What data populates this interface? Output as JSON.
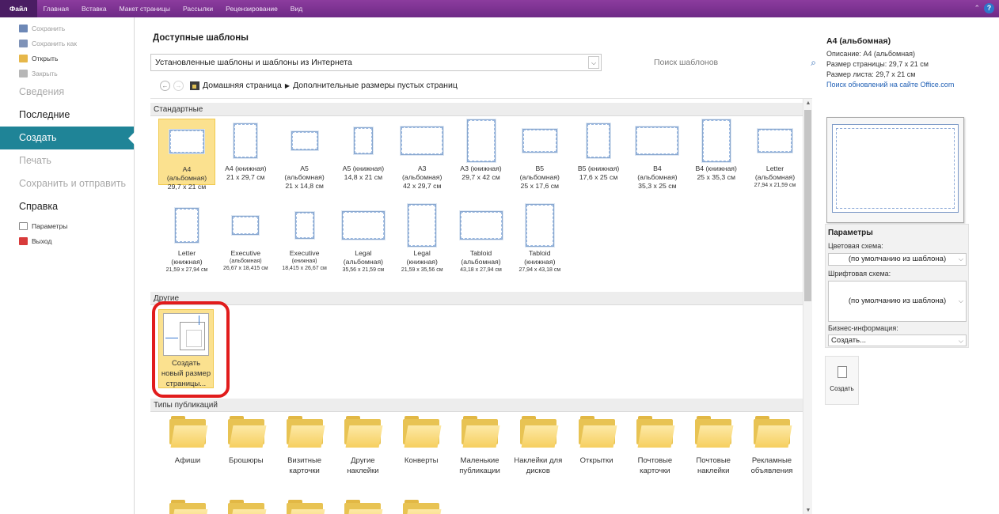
{
  "ribbon": {
    "tabs": [
      "Файл",
      "Главная",
      "Вставка",
      "Макет страницы",
      "Рассылки",
      "Рецензирование",
      "Вид"
    ]
  },
  "nav": {
    "small_items": [
      {
        "label": "Сохранить",
        "icon": "save-icon",
        "enabled": false
      },
      {
        "label": "Сохранить как",
        "icon": "save-as-icon",
        "enabled": false
      },
      {
        "label": "Открыть",
        "icon": "open-folder-icon",
        "enabled": true
      },
      {
        "label": "Закрыть",
        "icon": "close-file-icon",
        "enabled": false
      }
    ],
    "info": "Сведения",
    "recent": "Последние",
    "create": "Создать",
    "print": "Печать",
    "save_send": "Сохранить и отправить",
    "help": "Справка",
    "options": "Параметры",
    "exit": "Выход"
  },
  "center": {
    "title": "Доступные шаблоны",
    "combo_value": "Установленные шаблоны и шаблоны из Интернета",
    "search_placeholder": "Поиск шаблонов",
    "breadcrumb": {
      "home": "Домашняя страница",
      "separator": "▶",
      "current": "Дополнительные размеры пустых страниц"
    },
    "sections": {
      "standard": "Стандартные",
      "other": "Другие",
      "pub_types": "Типы публикаций"
    },
    "standard_tiles": [
      {
        "l1": "A4",
        "l2": "(альбомная)",
        "size": "29,7 x 21 см",
        "selected": true
      },
      {
        "l1": "A4 (книжная)",
        "l2": "",
        "size": "21 x 29,7 см"
      },
      {
        "l1": "A5",
        "l2": "(альбомная)",
        "size": "21 x 14,8 см"
      },
      {
        "l1": "A5 (книжная)",
        "l2": "",
        "size": "14,8 x 21 см"
      },
      {
        "l1": "A3",
        "l2": "(альбомная)",
        "size": "42 x 29,7 см"
      },
      {
        "l1": "A3 (книжная)",
        "l2": "",
        "size": "29,7 x 42 см"
      },
      {
        "l1": "B5",
        "l2": "(альбомная)",
        "size": "25 x 17,6 см"
      },
      {
        "l1": "B5 (книжная)",
        "l2": "",
        "size": "17,6 x 25 см"
      },
      {
        "l1": "B4",
        "l2": "(альбомная)",
        "size": "35,3 x 25 см"
      },
      {
        "l1": "B4 (книжная)",
        "l2": "",
        "size": "25 x 35,3 см"
      },
      {
        "l1": "Letter",
        "l2": "(альбомная)",
        "size": "27,94 x 21,59 см"
      }
    ],
    "standard_tiles_row2": [
      {
        "l1": "Letter",
        "l2": "(книжная)",
        "size": "21,59 x 27,94 см"
      },
      {
        "l1": "Executive",
        "l2": "(альбомная)",
        "size": "26,67 x 18,415 см"
      },
      {
        "l1": "Executive",
        "l2": "(книжная)",
        "size": "18,415 x 26,67 см"
      },
      {
        "l1": "Legal",
        "l2": "(альбомная)",
        "size": "35,56 x 21,59 см"
      },
      {
        "l1": "Legal",
        "l2": "(книжная)",
        "size": "21,59 x 35,56 см"
      },
      {
        "l1": "Tabloid",
        "l2": "(альбомная)",
        "size": "43,18 x 27,94 см"
      },
      {
        "l1": "Tabloid",
        "l2": "(книжная)",
        "size": "27,94 x 43,18 см"
      }
    ],
    "other_tile": {
      "l1": "Создать",
      "l2": "новый размер",
      "l3": "страницы..."
    },
    "folders": [
      {
        "l1": "Афиши",
        "l2": ""
      },
      {
        "l1": "Брошюры",
        "l2": ""
      },
      {
        "l1": "Визитные",
        "l2": "карточки"
      },
      {
        "l1": "Другие",
        "l2": "наклейки"
      },
      {
        "l1": "Конверты",
        "l2": ""
      },
      {
        "l1": "Маленькие",
        "l2": "публикации"
      },
      {
        "l1": "Наклейки для",
        "l2": "дисков"
      },
      {
        "l1": "Открытки",
        "l2": ""
      },
      {
        "l1": "Почтовые",
        "l2": "карточки"
      },
      {
        "l1": "Почтовые",
        "l2": "наклейки"
      },
      {
        "l1": "Рекламные",
        "l2": "объявления"
      }
    ]
  },
  "right": {
    "title": "A4 (альбомная)",
    "description": "Описание: A4 (альбомная)",
    "page_size": "Размер страницы: 29,7 x 21 см",
    "sheet_size": "Размер листа: 29,7 x 21 см",
    "update_link": "Поиск обновлений на сайте Office.com",
    "params_title": "Параметры",
    "color_scheme_label": "Цветовая схема:",
    "color_scheme_value": "(по умолчанию из шаблона)",
    "font_scheme_label": "Шрифтовая схема:",
    "font_scheme_value": "(по умолчанию из шаблона)",
    "biz_label": "Бизнес-информация:",
    "biz_value": "Создать...",
    "create_button": "Создать"
  },
  "colors": {
    "ribbon": "#7b2f91",
    "nav_selected": "#1f8497",
    "tile_selected": "#fbe18f",
    "highlight_box": "#e11c1c"
  }
}
